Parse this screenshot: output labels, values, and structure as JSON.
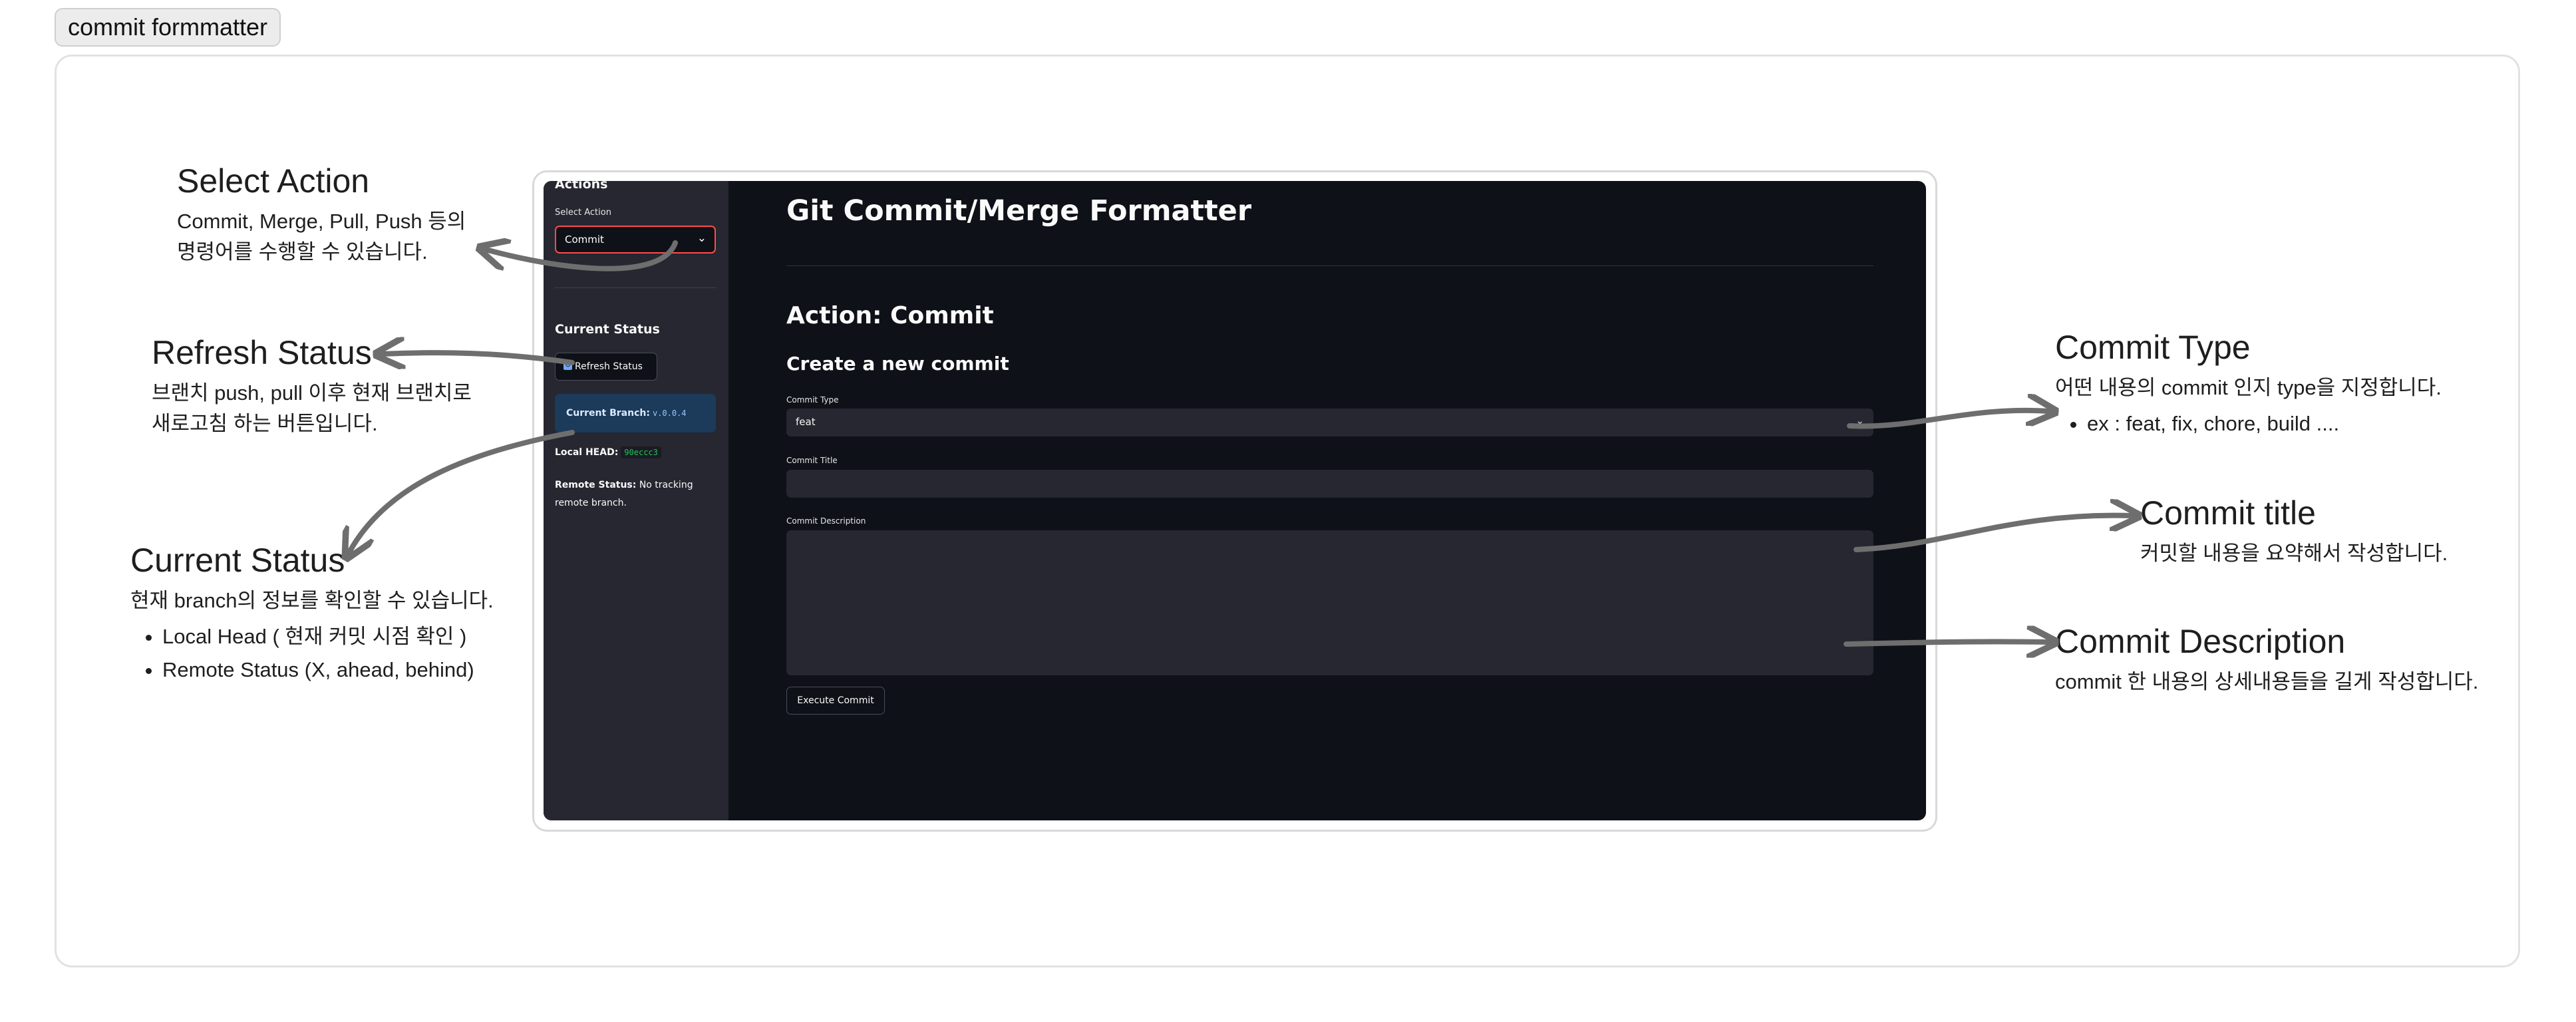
{
  "frame_title": "commit formmatter",
  "annotations": {
    "select_action": {
      "title": "Select Action",
      "desc_line1": "Commit, Merge, Pull, Push 등의",
      "desc_line2": "명령어를 수행할 수 있습니다."
    },
    "refresh_status": {
      "title": "Refresh Status",
      "desc_line1": "브랜치 push, pull 이후 현재 브랜치로",
      "desc_line2": "새로고침 하는 버튼입니다."
    },
    "current_status": {
      "title": "Current Status",
      "desc": "현재 branch의 정보를 확인할 수 있습니다.",
      "bullets": [
        "Local Head ( 현재 커밋 시점 확인 )",
        "Remote Status (X, ahead, behind)"
      ]
    },
    "commit_type": {
      "title": "Commit Type",
      "desc": "어떤 내용의 commit 인지 type을 지정합니다.",
      "bullets": [
        "ex : feat, fix, chore, build ...."
      ]
    },
    "commit_title": {
      "title": "Commit title",
      "desc": "커밋할 내용을 요약해서 작성합니다."
    },
    "commit_description": {
      "title": "Commit Description",
      "desc": "commit 한 내용의 상세내용들을 길게 작성합니다."
    }
  },
  "app": {
    "sidebar": {
      "header": "Actions",
      "select_label": "Select Action",
      "select_value": "Commit",
      "current_status_heading": "Current Status",
      "refresh_button": "Refresh Status",
      "current_branch_label": "Current Branch:",
      "current_branch_value": "v.0.0.4",
      "local_head_label": "Local HEAD:",
      "local_head_value": "90eccc3",
      "remote_status_label": "Remote Status:",
      "remote_status_value": "No tracking remote branch."
    },
    "main": {
      "title": "Git Commit/Merge Formatter",
      "action_heading": "Action: Commit",
      "subheading": "Create a new commit",
      "commit_type_label": "Commit Type",
      "commit_type_value": "feat",
      "commit_title_label": "Commit Title",
      "commit_title_value": "",
      "commit_description_label": "Commit Description",
      "commit_description_value": "",
      "execute_button": "Execute Commit"
    }
  },
  "colors": {
    "app_bg": "#0e1117",
    "sidebar_bg": "#262730",
    "accent": "#ff4b4b",
    "branch_info_bg": "#1c3a5a",
    "hash_green": "#21c354",
    "arrow": "#6e6e6e"
  }
}
